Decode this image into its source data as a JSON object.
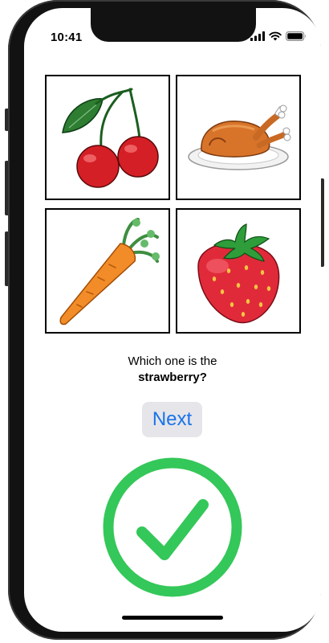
{
  "status_bar": {
    "time": "10:41",
    "icons": [
      "signal-icon",
      "wifi-icon",
      "battery-icon"
    ]
  },
  "choices": [
    {
      "name": "cherries",
      "icon": "cherries-image"
    },
    {
      "name": "roast chicken",
      "icon": "roast-chicken-image"
    },
    {
      "name": "carrot",
      "icon": "carrot-image"
    },
    {
      "name": "strawberry",
      "icon": "strawberry-image"
    }
  ],
  "question": {
    "prefix": "Which one is the",
    "target": "strawberry?"
  },
  "next_button": {
    "label": "Next"
  },
  "result": {
    "icon": "checkmark-circle-icon",
    "color": "#34c759"
  }
}
